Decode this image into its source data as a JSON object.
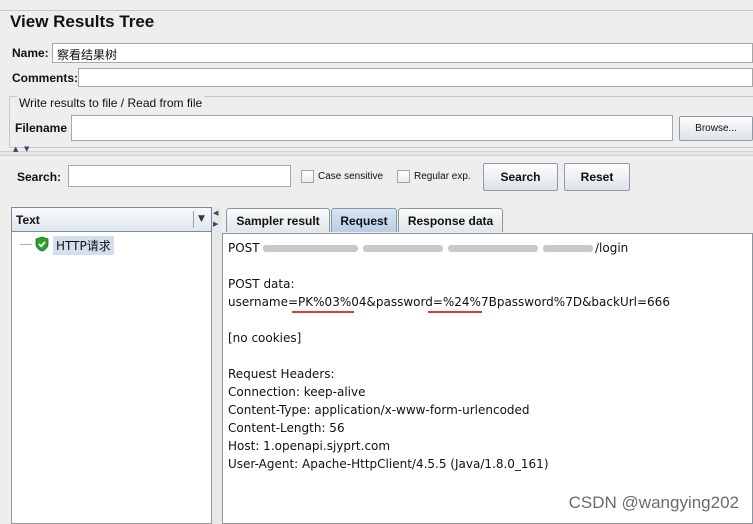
{
  "window": {
    "title": "View Results Tree"
  },
  "form": {
    "name_label": "Name:",
    "name_value": "察看结果树",
    "comments_label": "Comments:",
    "comments_value": ""
  },
  "file_section": {
    "group_title": "Write results to file / Read from file",
    "filename_label": "Filename",
    "filename_value": "",
    "browse_label": "Browse..."
  },
  "search": {
    "label": "Search:",
    "value": "",
    "case_sensitive_label": "Case sensitive",
    "case_sensitive_checked": false,
    "regex_label": "Regular exp.",
    "regex_checked": false,
    "search_button": "Search",
    "reset_button": "Reset"
  },
  "tree": {
    "renderer_select": "Text",
    "items": [
      {
        "label": "HTTP请求",
        "status": "success",
        "icon": "shield-check-icon"
      }
    ]
  },
  "tabs": [
    {
      "label": "Sampler result",
      "active": false
    },
    {
      "label": "Request",
      "active": true
    },
    {
      "label": "Response data",
      "active": false
    }
  ],
  "request": {
    "post_prefix": "POST",
    "url_suffix": "/login",
    "lines": [
      "POST data:",
      "username=PK%03%04&password=%24%7Bpassword%7D&backUrl=666",
      "",
      "[no cookies]",
      "",
      "Request Headers:",
      "Connection: keep-alive",
      "Content-Type: application/x-www-form-urlencoded",
      "Content-Length: 56",
      "Host: 1.openapi.sjyprt.com",
      "User-Agent: Apache-HttpClient/4.5.5 (Java/1.8.0_161)"
    ]
  },
  "watermark": "CSDN @wangying202",
  "colors": {
    "accent_tab": "#c4d7ea",
    "success_icon": "#2ea12e",
    "underline": "#e23a2e"
  }
}
